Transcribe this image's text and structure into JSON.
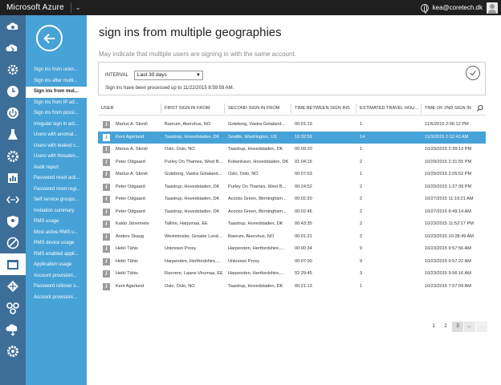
{
  "topbar": {
    "brand": "Microsoft Azure",
    "user_email": "kea@coretech.dk"
  },
  "rail": {
    "icons": [
      "cloud-services-icon",
      "web-sites-icon",
      "gear-icon",
      "clock-icon",
      "power-icon",
      "flask-icon",
      "settings-gear-icon",
      "chart-icon",
      "code-icon",
      "identity-icon",
      "blocked-icon",
      "window-icon",
      "diamond-icon",
      "network-icon",
      "cloud-sync-icon",
      "settings-icon"
    ],
    "active_index": 11
  },
  "subnav": {
    "items": [
      "Sign ins from unkn...",
      "Sign ins after multi...",
      "Sign ins from mul...",
      "Sign ins from IP ad...",
      "Sign ins from possi...",
      "Irregular sign in act...",
      "Users with anomal...",
      "Users with leaked c...",
      "Users with threaten...",
      "Audit report",
      "Password reset acti...",
      "Password reset regi...",
      "Self service groups...",
      "Invitation summary",
      "RMS usage",
      "Most active RMS u...",
      "RMS device usage",
      "RMS enabled appli...",
      "Application usage",
      "Account provisioni...",
      "Password rollover s...",
      "Account provisioni..."
    ],
    "active_index": 2
  },
  "main": {
    "title": "sign ins from multiple geographies",
    "subtitle": "May indicate that multiple users are signing in with the same account.",
    "interval_label": "INTERVAL",
    "interval_value": "Last 30 days",
    "processed_text": "Sign ins have been processed up to 11/22/2015 8:59:59 AM."
  },
  "table": {
    "columns": [
      "USER",
      "FIRST SIGN IN FROM",
      "SECOND SIGN IN FROM",
      "TIME BETWEEN SIGN INS",
      "ESTIMATED TRAVEL HOU...",
      "TIME OF 2ND SIGN IN"
    ],
    "selected_row": 1,
    "rows": [
      [
        "Marius A. Skovli",
        "Baerum, Akershus, NO",
        "Goteborg, Vastra Gotaland...",
        "00:01:19",
        "1",
        "11/6/2015 2:06:12 PM"
      ],
      [
        "Kent Agerlund",
        "Taastrup, Hovedstaden, DK",
        "Seattle, Washington, US",
        "10:32:59",
        "14",
        "11/3/2015 2:12:43 AM"
      ],
      [
        "Marius A. Skovli",
        "Oslo, Oslo, NO",
        "Taastrup, Hovedstaden, DK",
        "00:09:20",
        "1",
        "10/29/2015 2:39:13 PM"
      ],
      [
        "Peter Odgaard",
        "Purley On Thames, West B...",
        "Kobenhavn, Hovedstaden, DK",
        "01:04:16",
        "2",
        "10/29/2015 2:31:55 PM"
      ],
      [
        "Marius A. Skovli",
        "Goteborg, Vastra Gotaland...",
        "Oslo, Oslo, NO",
        "00:07:03",
        "1",
        "10/29/2015 2:05:52 PM"
      ],
      [
        "Peter Odgaard",
        "Taastrup, Hovedstaden, DK",
        "Purley On Thames, West B...",
        "00:24:52",
        "2",
        "10/29/2015 1:27:39 PM"
      ],
      [
        "Peter Odgaard",
        "Taastrup, Hovedstaden, DK",
        "Acocks Green, Birmingham...",
        "00:02:20",
        "2",
        "10/27/2015 11:19:21 AM"
      ],
      [
        "Peter Odgaard",
        "Taastrup, Hovedstaden, DK",
        "Acocks Green, Birmingham...",
        "00:02:46",
        "2",
        "10/27/2015 8:49:14 AM"
      ],
      [
        "Kaido Järvemets",
        "Tallinn, Harjumaa, EE",
        "Taastrup, Hovedstaden, DK",
        "00:43:35",
        "2",
        "10/23/2015 11:52:17 PM"
      ],
      [
        "Anders Skaug",
        "Westminster, Greater Lond...",
        "Baerum, Akershus, NO",
        "00:01:21",
        "2",
        "10/23/2015 10:28:49 AM"
      ],
      [
        "Heikí Tähis",
        "Unknown Proxy",
        "Harpenden, Hertfordshire,...",
        "00:00:34",
        "9",
        "10/23/2015 9:57:56 AM"
      ],
      [
        "Heikí Tähis",
        "Harpenden, Hertfordshire,...",
        "Unknown Proxy",
        "00:07:00",
        "9",
        "10/23/2015 9:57:22 AM"
      ],
      [
        "Heikí Tähis",
        "Raxvere, Laane-Virumaa, EE",
        "Harpenden, Hertfordshire,...",
        "02:29:45",
        "3",
        "10/23/2015 9:56:16 AM"
      ],
      [
        "Kent Agerlund",
        "Oslo, Oslo, NO",
        "Taastrup, Hovedstaden, DK",
        "00:21:13",
        "1",
        "10/23/2015 7:07:09 AM"
      ]
    ]
  },
  "pager": {
    "pages": [
      "1",
      "2",
      "3"
    ],
    "current_page": "3",
    "prev": "←",
    "next": "→"
  }
}
